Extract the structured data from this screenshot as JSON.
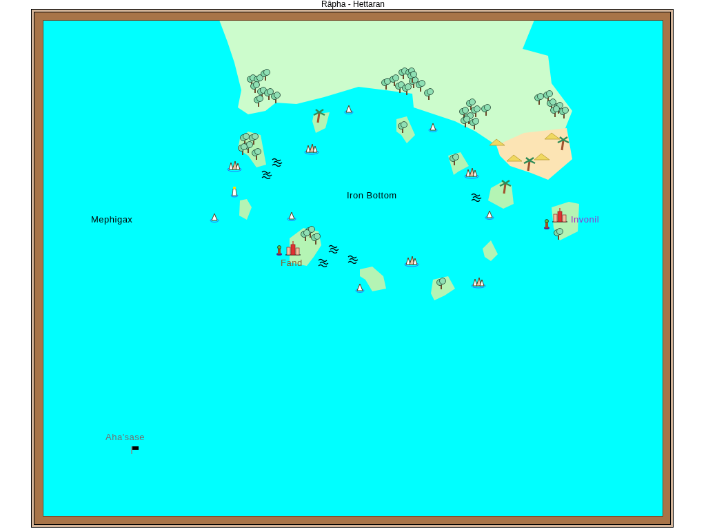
{
  "window": {
    "title": "Râpha - Hettaran"
  },
  "map": {
    "labels": [
      {
        "text": "Iron Bottom",
        "color": "#000000"
      },
      {
        "text": "Mephigax",
        "color": "#000000"
      },
      {
        "text": "Invonil",
        "color": "#9933cc"
      },
      {
        "text": "Fand",
        "color": "#8b5a2b"
      },
      {
        "text": "Aha'sase",
        "color": "#707070"
      }
    ]
  }
}
